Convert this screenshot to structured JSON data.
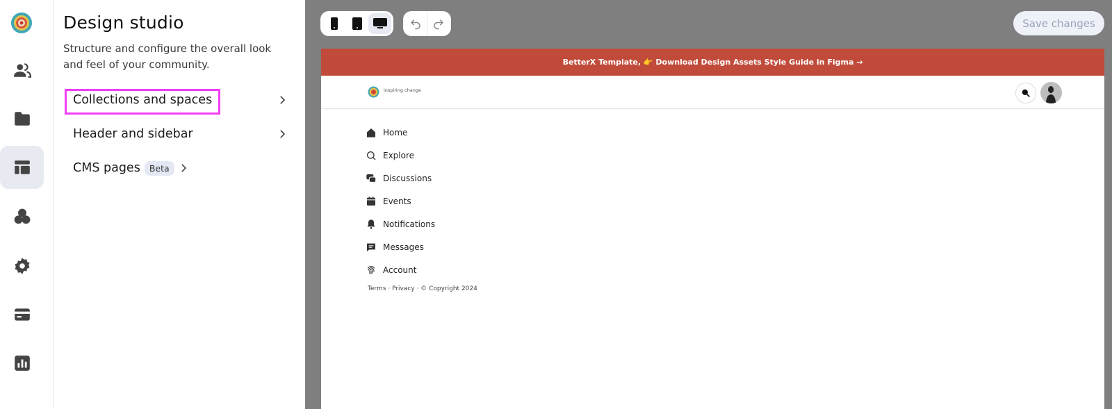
{
  "rail": {
    "items": [
      {
        "name": "members",
        "icon": "people-icon"
      },
      {
        "name": "content",
        "icon": "folder-icon"
      },
      {
        "name": "design-studio",
        "icon": "layout-icon",
        "active": true
      },
      {
        "name": "apps",
        "icon": "circles-icon"
      },
      {
        "name": "settings",
        "icon": "gear-icon"
      },
      {
        "name": "billing",
        "icon": "card-icon"
      },
      {
        "name": "analytics",
        "icon": "chart-icon"
      }
    ]
  },
  "panel": {
    "title": "Design studio",
    "description": "Structure and configure the overall look and feel of your community.",
    "nav": [
      {
        "label": "Collections and spaces"
      },
      {
        "label": "Header and sidebar"
      },
      {
        "label": "CMS pages",
        "badge": "Beta"
      }
    ]
  },
  "toolbar": {
    "devices": [
      "mobile",
      "tablet",
      "desktop"
    ],
    "selected_device": "desktop",
    "save_label": "Save changes"
  },
  "preview": {
    "banner": "BetterX Template, 👉 Download Design Assets Style Guide in Figma →",
    "site_tagline": "inspiring change",
    "nav": [
      {
        "label": "Home",
        "icon": "home-icon"
      },
      {
        "label": "Explore",
        "icon": "search-icon"
      },
      {
        "label": "Discussions",
        "icon": "chat-bubbles-icon"
      },
      {
        "label": "Events",
        "icon": "calendar-icon"
      },
      {
        "label": "Notifications",
        "icon": "bell-icon"
      },
      {
        "label": "Messages",
        "icon": "message-icon"
      },
      {
        "label": "Account",
        "icon": "fingerprint-icon"
      }
    ],
    "footer": "Terms · Privacy · © Copyright 2024"
  },
  "colors": {
    "banner": "#c14b3a",
    "highlight": "#f23ff5",
    "active_rail": "#e8eaf1",
    "preview_bg": "#7f7f7f"
  }
}
